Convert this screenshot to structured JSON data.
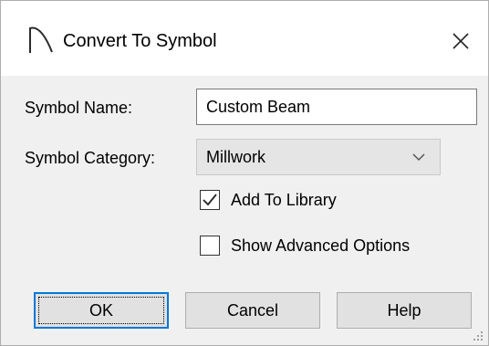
{
  "dialog": {
    "title": "Convert To Symbol",
    "app_icon": "arc-icon",
    "close_icon": "close-icon"
  },
  "form": {
    "symbol_name_label": "Symbol Name:",
    "symbol_name_value": "Custom Beam",
    "symbol_category_label": "Symbol Category:",
    "symbol_category_value": "Millwork",
    "add_to_library_label": "Add To Library",
    "add_to_library_checked": true,
    "show_advanced_label": "Show Advanced Options",
    "show_advanced_checked": false
  },
  "buttons": {
    "ok": "OK",
    "cancel": "Cancel",
    "help": "Help"
  },
  "colors": {
    "accent": "#0078d7",
    "window_bg": "#f0f0f0"
  }
}
